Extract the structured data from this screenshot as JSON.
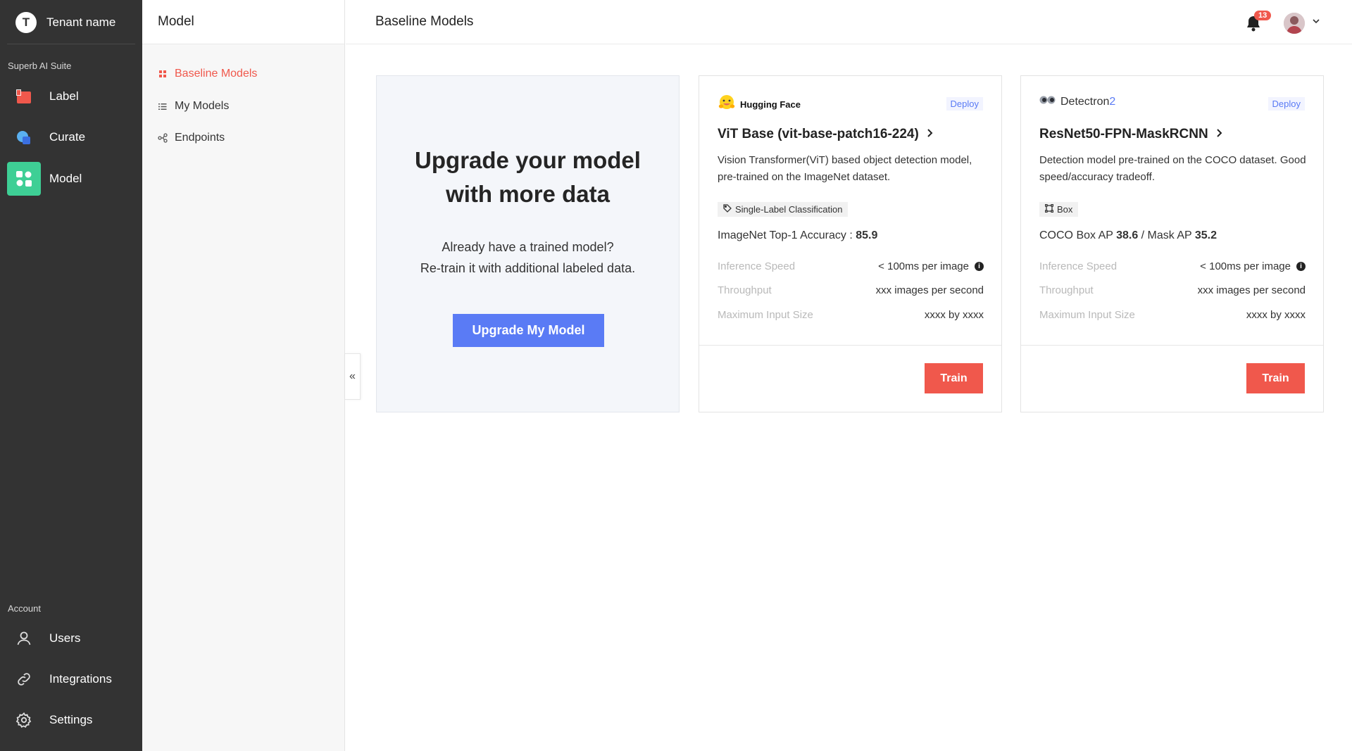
{
  "rail": {
    "tenant_initial": "T",
    "tenant_name": "Tenant name",
    "suite_label": "Superb AI Suite",
    "items": [
      {
        "label": "Label",
        "icon": "label-icon"
      },
      {
        "label": "Curate",
        "icon": "curate-icon"
      },
      {
        "label": "Model",
        "icon": "model-icon",
        "active": true
      }
    ],
    "account_label": "Account",
    "account_items": [
      {
        "label": "Users",
        "icon": "user-icon"
      },
      {
        "label": "Integrations",
        "icon": "link-icon"
      },
      {
        "label": "Settings",
        "icon": "gear-icon"
      }
    ]
  },
  "subnav": {
    "title": "Model",
    "items": [
      {
        "label": "Baseline Models",
        "icon": "grid-icon",
        "active": true
      },
      {
        "label": "My Models",
        "icon": "list-icon"
      },
      {
        "label": "Endpoints",
        "icon": "endpoints-icon"
      }
    ],
    "collapse_glyph": "«"
  },
  "header": {
    "title": "Baseline Models",
    "notification_count": "13"
  },
  "upgrade": {
    "title_line1": "Upgrade your model",
    "title_line2": "with more data",
    "text_line1": "Already have a trained model?",
    "text_line2": "Re-train it with additional labeled data.",
    "button": "Upgrade My Model"
  },
  "models": [
    {
      "brand": "Hugging Face",
      "deploy": "Deploy",
      "title": "ViT Base (vit-base-patch16-224)",
      "desc": "Vision Transformer(ViT) based object detection model, pre-trained on the ImageNet dataset.",
      "tag": "Single-Label Classification",
      "metric_prefix": "ImageNet Top-1 Accuracy : ",
      "metric_value": "85.9",
      "specs": {
        "inference_key": "Inference Speed",
        "inference_val": "< 100ms per image",
        "throughput_key": "Throughput",
        "throughput_val": "xxx images per second",
        "input_key": "Maximum Input Size",
        "input_val": "xxxx by xxxx"
      },
      "train": "Train"
    },
    {
      "brand_a": "Detectron",
      "brand_b": "2",
      "deploy": "Deploy",
      "title": "ResNet50-FPN-MaskRCNN",
      "desc": "Detection model pre-trained on the COCO dataset. Good speed/accuracy tradeoff.",
      "tag": "Box",
      "metric_a": "COCO Box AP ",
      "metric_a_val": "38.6",
      "metric_b": " / Mask AP ",
      "metric_b_val": "35.2",
      "specs": {
        "inference_key": "Inference Speed",
        "inference_val": "< 100ms per image",
        "throughput_key": "Throughput",
        "throughput_val": "xxx images per second",
        "input_key": "Maximum Input Size",
        "input_val": "xxxx by xxxx"
      },
      "train": "Train"
    }
  ],
  "colors": {
    "rail_bg": "#333333",
    "accent_red": "#f0584c",
    "accent_blue": "#5a7bf5",
    "accent_green": "#3ecf95"
  }
}
